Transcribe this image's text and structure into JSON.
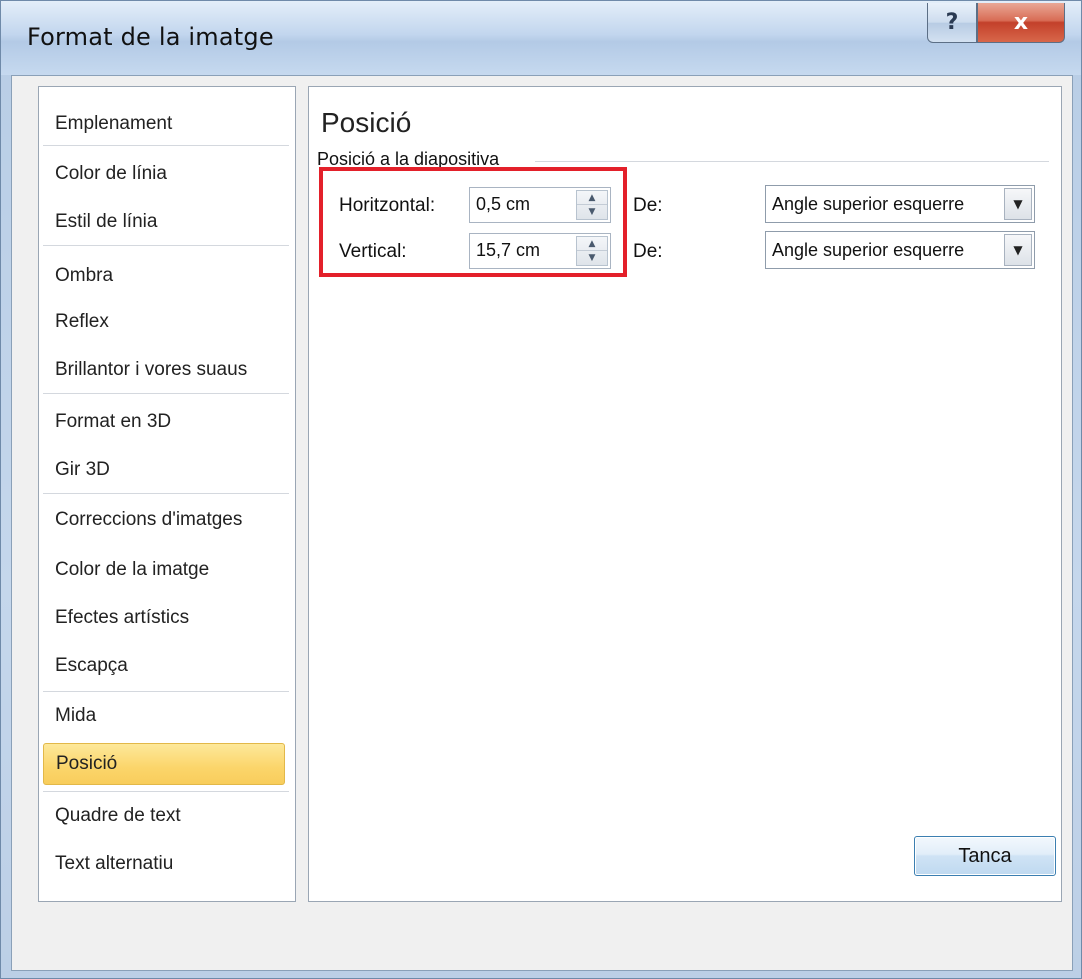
{
  "window": {
    "title": "Format de la imatge",
    "help_label": "?",
    "close_label": "x"
  },
  "sidebar": {
    "items": [
      {
        "label": "Emplenament",
        "selected": false
      },
      {
        "label": "Color de línia",
        "selected": false
      },
      {
        "label": "Estil de línia",
        "selected": false
      },
      {
        "label": "Ombra",
        "selected": false
      },
      {
        "label": "Reflex",
        "selected": false
      },
      {
        "label": "Brillantor i vores suaus",
        "selected": false
      },
      {
        "label": "Format en 3D",
        "selected": false
      },
      {
        "label": "Gir 3D",
        "selected": false
      },
      {
        "label": "Correccions d'imatges",
        "selected": false
      },
      {
        "label": "Color de la imatge",
        "selected": false
      },
      {
        "label": "Efectes artístics",
        "selected": false
      },
      {
        "label": "Escapça",
        "selected": false
      },
      {
        "label": "Mida",
        "selected": false
      },
      {
        "label": "Posició",
        "selected": true
      },
      {
        "label": "Quadre de text",
        "selected": false
      },
      {
        "label": "Text alternatiu",
        "selected": false
      }
    ]
  },
  "panel": {
    "heading": "Posició",
    "group_label": "Posició a la diapositiva",
    "horizontal": {
      "label": "Horitzontal:",
      "value": "0,5 cm",
      "from_label": "De:",
      "from_value": "Angle superior esquerre"
    },
    "vertical": {
      "label": "Vertical:",
      "value": "15,7 cm",
      "from_label": "De:",
      "from_value": "Angle superior esquerre"
    }
  },
  "footer": {
    "close_button_label": "Tanca"
  },
  "colors": {
    "selected_item": "#fbd56a",
    "highlight_box": "#e3202a",
    "close_button": "#c3402a"
  },
  "icons": {
    "spin_up": "triangle-up",
    "spin_down": "triangle-down",
    "dropdown": "triangle-down",
    "help": "question-mark",
    "close": "x"
  }
}
